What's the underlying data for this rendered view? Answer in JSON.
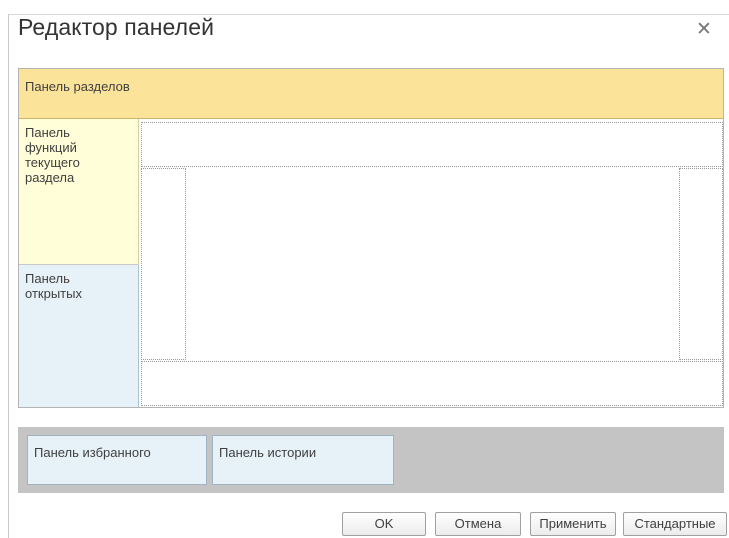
{
  "dialog": {
    "title": "Редактор панелей",
    "close_icon": "close-icon"
  },
  "panels": {
    "sections": "Панель разделов",
    "functions": "Панель функций текущего раздела",
    "open": "Панель открытых",
    "favorites": "Панель избранного",
    "history": "Панель истории"
  },
  "buttons": {
    "ok": "OK",
    "cancel": "Отмена",
    "apply": "Применить",
    "default": "Стандартные"
  },
  "colors": {
    "sections_panel": "#fbe49a",
    "functions_panel": "#fffed8",
    "open_panel": "#e7f2f8",
    "bottom_area": "#c4c4c4"
  }
}
